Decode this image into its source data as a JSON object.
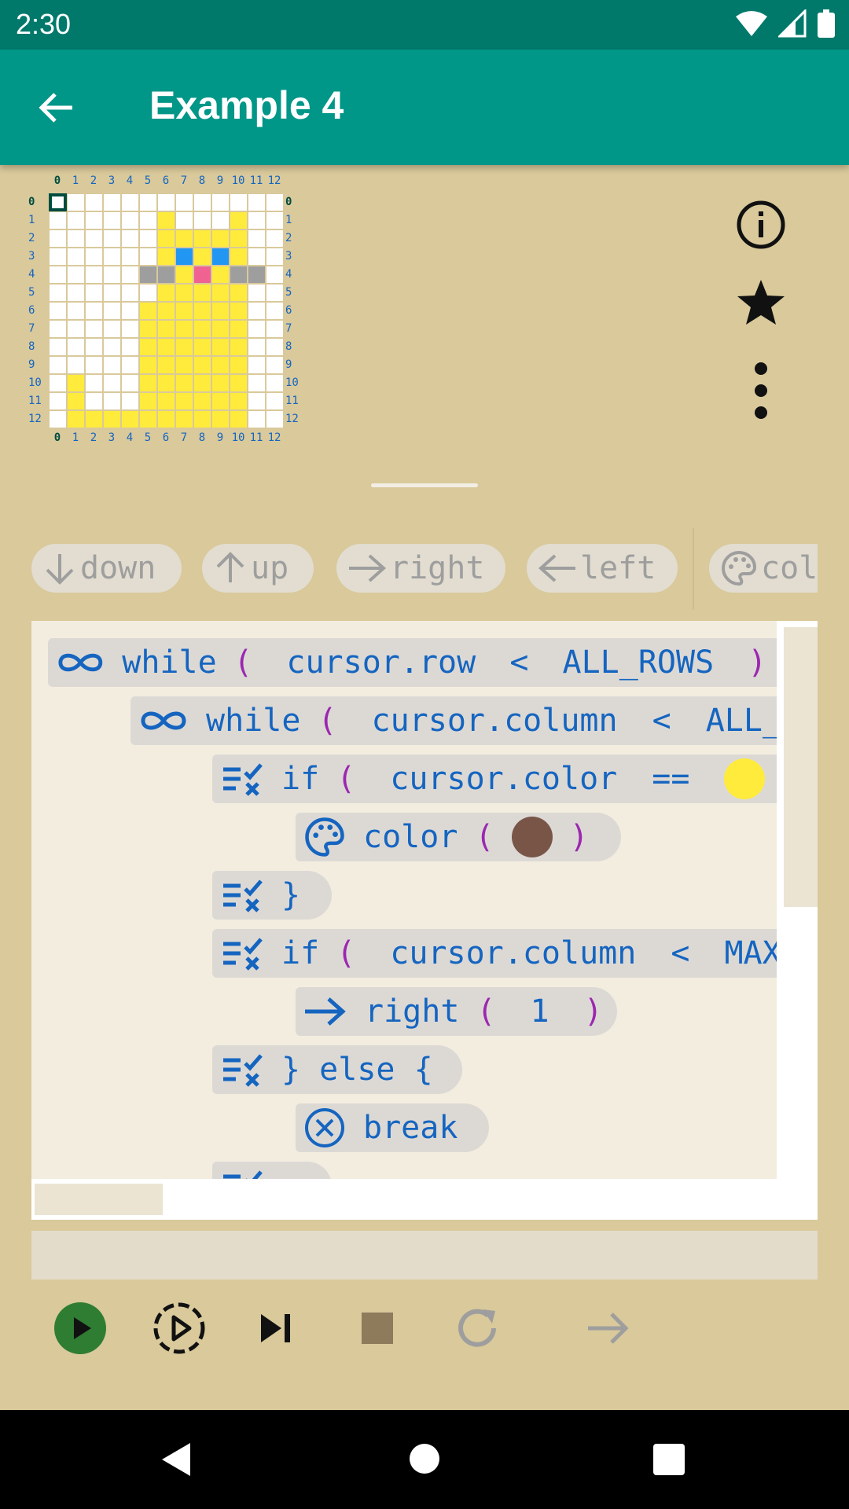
{
  "status_bar": {
    "time": "2:30"
  },
  "app_bar": {
    "title": "Example 4"
  },
  "grid": {
    "col_labels": [
      "0",
      "1",
      "2",
      "3",
      "4",
      "5",
      "6",
      "7",
      "8",
      "9",
      "10",
      "11",
      "12"
    ],
    "row_labels": [
      "0",
      "1",
      "2",
      "3",
      "4",
      "5",
      "6",
      "7",
      "8",
      "9",
      "10",
      "11",
      "12"
    ],
    "rows": [
      "WWWWWWWWWWWWW",
      "WWWWWWYWWWYWW",
      "WWWWWWYYYYYWW",
      "WWWWWWYBYBYWW",
      "WWWWWGGYPYGGW",
      "WWWWWWYYYYYWW",
      "WWWWWYYYYYYWW",
      "WWWWWYYYYYYWW",
      "WWWWWYYYYYYWW",
      "WWWWWYYYYYYWW",
      "WYWWWYYYYYYWW",
      "WYWWWYYYYYYWW",
      "WYYYYYYYYYYWW"
    ],
    "palette": {
      "W": "#ffffff",
      "Y": "#ffeb3b",
      "B": "#2196f3",
      "G": "#9e9e9e",
      "P": "#f06292"
    },
    "cursor": {
      "row": 0,
      "column": 0
    }
  },
  "side_actions": [
    {
      "icon": "info-icon"
    },
    {
      "icon": "star-icon"
    },
    {
      "icon": "more-vert-icon"
    }
  ],
  "toolbar": {
    "down": "down",
    "up": "up",
    "right": "right",
    "left": "left",
    "color": "col"
  },
  "code": {
    "l1": {
      "kw": "while",
      "open": "(",
      "expr1": "cursor.row",
      "op": "<",
      "expr2": "ALL_ROWS",
      "close": ")",
      "brace": "{"
    },
    "l2": {
      "kw": "while",
      "open": "(",
      "expr1": "cursor.column",
      "op": "<",
      "expr2": "ALL_C"
    },
    "l3": {
      "kw": "if",
      "open": "(",
      "expr1": "cursor.color",
      "op": "==",
      "close": ")",
      "dot_color": "#ffeb3b"
    },
    "l4": {
      "kw": "color",
      "open": "(",
      "close": ")",
      "dot_color": "#795548"
    },
    "l5": {
      "kw": "}"
    },
    "l6": {
      "kw": "if",
      "open": "(",
      "expr1": "cursor.column",
      "op": "<",
      "expr2": "MAX_"
    },
    "l7": {
      "kw": "right",
      "open": "(",
      "arg": "1",
      "close": ")"
    },
    "l8": {
      "kw": "} else {"
    },
    "l9": {
      "kw": "break"
    }
  },
  "controls": [
    {
      "icon": "play-icon",
      "color": "#2e7d32"
    },
    {
      "icon": "step-play-icon"
    },
    {
      "icon": "skip-next-icon"
    },
    {
      "icon": "stop-icon",
      "color": "#8d7b5c"
    },
    {
      "icon": "restart-icon",
      "color": "#9e9e9e"
    },
    {
      "icon": "arrow-right-icon",
      "color": "#9e9e9e"
    }
  ]
}
